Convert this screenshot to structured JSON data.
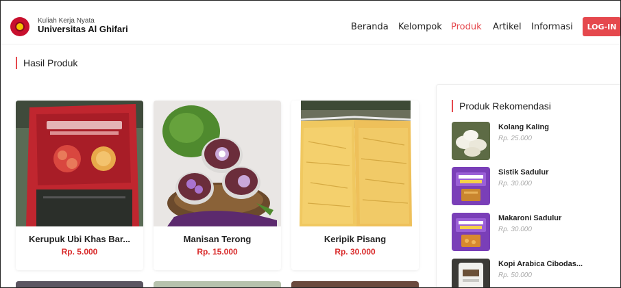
{
  "brand": {
    "subtitle": "Kuliah Kerja Nyata",
    "title": "Universitas Al Ghifari"
  },
  "nav": {
    "items": [
      "Beranda",
      "Kelompok",
      "Produk",
      "Artikel",
      "Informasi"
    ],
    "active": "Produk",
    "login_label": "LOG-IN"
  },
  "section_title": "Hasil Produk",
  "products": [
    {
      "name": "Kerupuk Ubi Khas Bar...",
      "price": "Rp. 5.000"
    },
    {
      "name": "Manisan Terong",
      "price": "Rp. 15.000"
    },
    {
      "name": "Keripik Pisang",
      "price": "Rp. 30.000"
    }
  ],
  "sidebar": {
    "title": "Produk Rekomendasi",
    "items": [
      {
        "name": "Kolang Kaling",
        "price": "Rp. 25.000"
      },
      {
        "name": "Sistik Sadulur",
        "price": "Rp. 30.000"
      },
      {
        "name": "Makaroni Sadulur",
        "price": "Rp. 30.000"
      },
      {
        "name": "Kopi Arabica Cibodas...",
        "price": "Rp. 50.000"
      }
    ]
  },
  "colors": {
    "accent": "#e5484d",
    "price": "#d92b2b"
  }
}
